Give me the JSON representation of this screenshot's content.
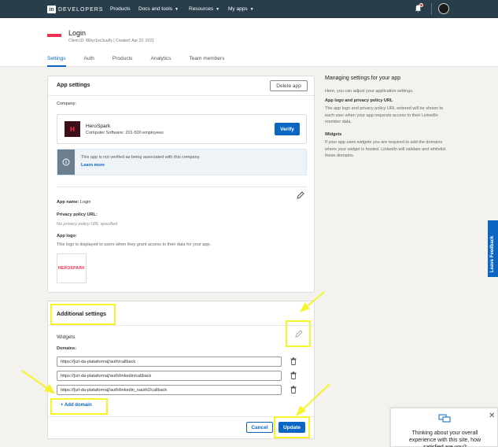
{
  "nav": {
    "logo_in": "in",
    "logo_text": "DEVELOPERS",
    "items": [
      {
        "label": "Products",
        "caret": false
      },
      {
        "label": "Docs and tools",
        "caret": true
      },
      {
        "label": "Resources",
        "caret": true
      },
      {
        "label": "My apps",
        "caret": true
      }
    ]
  },
  "header": {
    "app_title": "Login",
    "client_id_label": "Client ID:",
    "client_id": "86kyr1ec3uu8y",
    "created_label": "Created:",
    "created": "Apr 22, 2021",
    "tabs": [
      {
        "label": "Settings",
        "active": true
      },
      {
        "label": "Auth",
        "active": false
      },
      {
        "label": "Products",
        "active": false
      },
      {
        "label": "Analytics",
        "active": false
      },
      {
        "label": "Team members",
        "active": false
      }
    ]
  },
  "app_settings": {
    "title": "App settings",
    "delete_button": "Delete app",
    "company_label": "Company:",
    "company_name": "HeroSpark",
    "company_logo_letter": "H",
    "company_sub": "Computer Software: 201-500 employees",
    "verify_button": "Verify",
    "info_text": "This app is not verified as being associated with this company.",
    "info_link": "Learn more",
    "app_name_label": "App name:",
    "app_name": "Login",
    "privacy_label": "Privacy policy URL:",
    "privacy_value": "No privacy policy URL specified",
    "app_logo_label": "App logo:",
    "app_logo_desc": "This logo is displayed to users when they grant access to their data for your app.",
    "logo_preview_text": "HEROSPARK"
  },
  "side": {
    "title": "Managing settings for your app",
    "intro": "Here, you can adjust your application settings.",
    "h1": "App logo and privacy policy URL",
    "p1": "The app logo and privacy policy URL entered will be shown to each user when your app requests access to their LinkedIn member data.",
    "h2": "Widgets",
    "p2": "If your app uses widgets you are required to add the domains where your widget is hosted. LinkedIn will validate and whitelist these domains."
  },
  "additional": {
    "title": "Additional settings",
    "widgets_label": "Widgets",
    "domains_label": "Domains:",
    "domains": [
      "https://[url-da-plataforma]/auth/callback",
      "https://[url-da-plataforma]/auth/linkedin/callback",
      "https://[url-da-plataforma]/auth/linkedin_oauth2/callback"
    ],
    "add_domain": "+ Add domain",
    "cancel_button": "Cancel",
    "update_button": "Update"
  },
  "feedback_tab": "Leave Feedback",
  "survey_text": "Thinking about your overall experience with this site, how satisfied are you?",
  "colors": {
    "brand_blue": "#0a66c2",
    "nav_bg": "#283e4a",
    "highlight_yellow": "#f5f52a"
  }
}
